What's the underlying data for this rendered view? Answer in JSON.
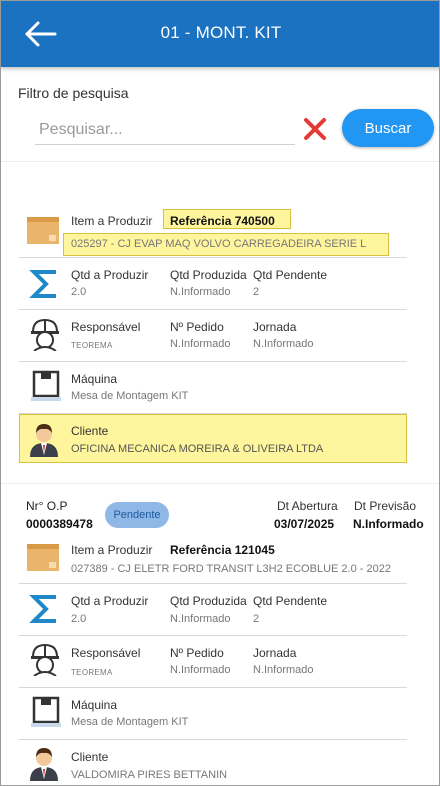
{
  "header": {
    "title": "01 - MONT. KIT",
    "back_icon": "arrow-left-icon"
  },
  "filter": {
    "label": "Filtro de pesquisa",
    "placeholder": "Pesquisar...",
    "search_label": "Buscar",
    "clear_icon": "close-icon"
  },
  "colors": {
    "primary": "#1a72c1",
    "button": "#2196f3",
    "highlight": "#fff59d",
    "badge": "#8fb8e6"
  },
  "cards": [
    {
      "item_label": "Item a Produzir",
      "ref_text": "Referência 740500",
      "description": "025297 - CJ EVAP MAQ VOLVO CARREGADEIRA SERIE L",
      "qtd_produzir_label": "Qtd a Produzir",
      "qtd_produzir": "2.0",
      "qtd_produzida_label": "Qtd Produzida",
      "qtd_produzida": "N.Informado",
      "qtd_pendente_label": "Qtd Pendente",
      "qtd_pendente": "2",
      "responsavel_label": "Responsável",
      "responsavel": "TEOREMA",
      "pedido_label": "Nº Pedido",
      "pedido": "N.Informado",
      "jornada_label": "Jornada",
      "jornada": "N.Informado",
      "maquina_label": "Máquina",
      "maquina": "Mesa de Montagem KIT",
      "cliente_label": "Cliente",
      "cliente": "OFICINA MECANICA MOREIRA & OLIVEIRA LTDA"
    },
    {
      "op_label": "Nr° O.P",
      "op_number": "0000389478",
      "status": "Pendente",
      "abertura_label": "Dt Abertura",
      "abertura": "03/07/2025",
      "previsao_label": "Dt Previsão",
      "previsao": "N.Informado",
      "item_label": "Item a Produzir",
      "ref_text": "Referência 121045",
      "description": "027389 - CJ ELETR FORD TRANSIT L3H2 ECOBLUE 2.0 - 2022",
      "qtd_produzir_label": "Qtd a Produzir",
      "qtd_produzir": "2.0",
      "qtd_produzida_label": "Qtd Produzida",
      "qtd_produzida": "N.Informado",
      "qtd_pendente_label": "Qtd Pendente",
      "qtd_pendente": "2",
      "responsavel_label": "Responsável",
      "responsavel": "TEOREMA",
      "pedido_label": "Nº Pedido",
      "pedido": "N.Informado",
      "jornada_label": "Jornada",
      "jornada": "N.Informado",
      "maquina_label": "Máquina",
      "maquina": "Mesa de Montagem KIT",
      "cliente_label": "Cliente",
      "cliente": "VALDOMIRA PIRES BETTANIN"
    }
  ],
  "icons": {
    "box": "box-icon",
    "sigma": "sigma-icon",
    "worker": "worker-helmet-icon",
    "machine": "machine-icon",
    "client": "client-person-icon"
  }
}
